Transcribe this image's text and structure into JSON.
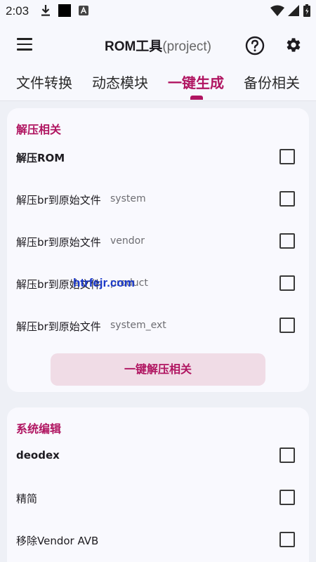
{
  "status_bar": {
    "time": "2:03",
    "icons": [
      "download-icon",
      "black-square-icon",
      "app-a-icon",
      "wifi-icon",
      "signal-icon",
      "battery-icon"
    ]
  },
  "app_bar": {
    "title_main": "ROM工具",
    "title_sub": "(project)",
    "icons": [
      "menu-icon",
      "help-icon",
      "settings-icon"
    ]
  },
  "tabs": [
    {
      "label": "文件转换",
      "active": false
    },
    {
      "label": "动态模块",
      "active": false
    },
    {
      "label": "一键生成",
      "active": true
    },
    {
      "label": "备份相关",
      "active": false
    }
  ],
  "section1": {
    "title": "解压相关",
    "rows": [
      {
        "label": "解压ROM",
        "value": "",
        "checked": false
      },
      {
        "label": "解压br到原始文件",
        "value": "system",
        "checked": false
      },
      {
        "label": "解压br到原始文件",
        "value": "vendor",
        "checked": false
      },
      {
        "label": "解压br到原始文件",
        "value": "product",
        "checked": false
      },
      {
        "label": "解压br到原始文件",
        "value": "system_ext",
        "checked": false
      }
    ],
    "button_label": "一键解压相关"
  },
  "section2": {
    "title": "系统编辑",
    "rows": [
      {
        "label": "deodex",
        "checked": false
      },
      {
        "label": "精简",
        "checked": false
      },
      {
        "label": "移除Vendor AVB",
        "checked": false
      }
    ]
  },
  "watermark": "htrfejr.com",
  "colors": {
    "accent": "#b01561",
    "button_bg": "#f0dce6",
    "background": "#eef0f6",
    "card": "#f9f9fe"
  }
}
